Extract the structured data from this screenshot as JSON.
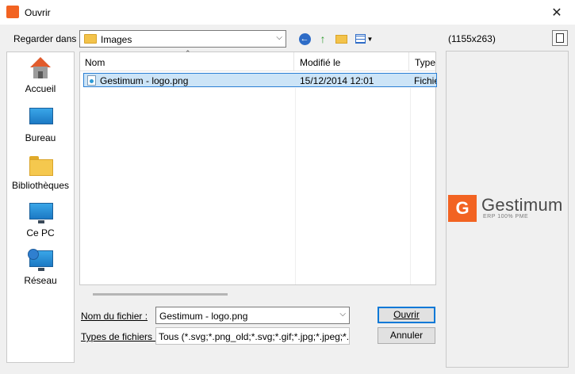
{
  "window": {
    "title": "Ouvrir",
    "close_glyph": "✕",
    "app_icon": "gestimum-app-icon"
  },
  "toolbar": {
    "look_in_label": "Regarder dans :",
    "look_in_value": "Images",
    "icons": [
      "back-icon",
      "up-folder-icon",
      "new-folder-icon",
      "view-menu-icon"
    ]
  },
  "sidebar": {
    "items": [
      {
        "label": "Accueil",
        "icon": "home-icon"
      },
      {
        "label": "Bureau",
        "icon": "desktop-icon"
      },
      {
        "label": "Bibliothèques",
        "icon": "libraries-icon"
      },
      {
        "label": "Ce PC",
        "icon": "computer-icon"
      },
      {
        "label": "Réseau",
        "icon": "network-icon"
      }
    ]
  },
  "file_list": {
    "columns": [
      "Nom",
      "Modifié le",
      "Type"
    ],
    "rows": [
      {
        "name": "Gestimum - logo.png",
        "modified": "15/12/2014 12:01",
        "type": "Fichier",
        "selected": true
      }
    ]
  },
  "bottom": {
    "filename_label": "Nom du fichier :",
    "filename_value": "Gestimum - logo.png",
    "filetype_label": "Types de fichiers :",
    "filetype_value": "Tous (*.svg;*.png_old;*.svg;*.gif;*.jpg;*.jpeg;*.gif",
    "open_button": "Ouvrir",
    "cancel_button": "Annuler"
  },
  "preview": {
    "dimensions": "(1155x263)",
    "logo_letter": "G",
    "brand": "Gestimum",
    "tagline": "ERP 100% PME"
  },
  "colors": {
    "accent": "#f26322",
    "selection": "#cce4f7",
    "selection_border": "#2b7fd4",
    "focus": "#0078d7"
  }
}
